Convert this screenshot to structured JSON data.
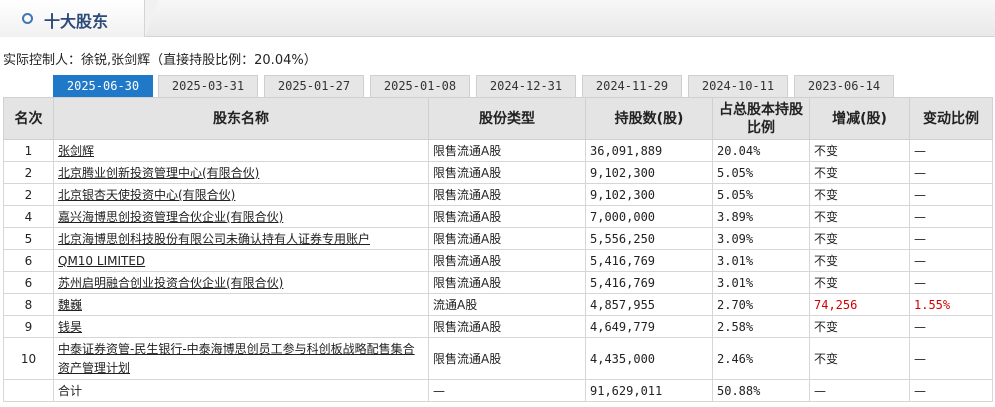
{
  "section": {
    "title": "十大股东"
  },
  "controller": {
    "label": "实际控制人：徐锐,张剑辉",
    "ratio_text": "（直接持股比例：20.04%）"
  },
  "date_tabs": [
    "2025-06-30",
    "2025-03-31",
    "2025-01-27",
    "2025-01-08",
    "2024-12-31",
    "2024-11-29",
    "2024-10-11",
    "2023-06-14"
  ],
  "active_tab": "2025-06-30",
  "table": {
    "headers": [
      "名次",
      "股东名称",
      "股份类型",
      "持股数(股)",
      "占总股本持股比例",
      "增减(股)",
      "变动比例"
    ],
    "rows": [
      {
        "rank": "1",
        "name": "张剑辉",
        "type": "限售流通A股",
        "shares": "36,091,889",
        "ratio": "20.04%",
        "change": "不变",
        "change_ratio": "—"
      },
      {
        "rank": "2",
        "name": "北京腾业创新投资管理中心(有限合伙)",
        "type": "限售流通A股",
        "shares": "9,102,300",
        "ratio": "5.05%",
        "change": "不变",
        "change_ratio": "—"
      },
      {
        "rank": "2",
        "name": "北京银杏天使投资中心(有限合伙)",
        "type": "限售流通A股",
        "shares": "9,102,300",
        "ratio": "5.05%",
        "change": "不变",
        "change_ratio": "—"
      },
      {
        "rank": "4",
        "name": "嘉兴海博思创投资管理合伙企业(有限合伙)",
        "type": "限售流通A股",
        "shares": "7,000,000",
        "ratio": "3.89%",
        "change": "不变",
        "change_ratio": "—"
      },
      {
        "rank": "5",
        "name": "北京海博思创科技股份有限公司未确认持有人证券专用账户",
        "type": "限售流通A股",
        "shares": "5,556,250",
        "ratio": "3.09%",
        "change": "不变",
        "change_ratio": "—"
      },
      {
        "rank": "6",
        "name": "QM10 LIMITED",
        "type": "限售流通A股",
        "shares": "5,416,769",
        "ratio": "3.01%",
        "change": "不变",
        "change_ratio": "—"
      },
      {
        "rank": "6",
        "name": "苏州启明融合创业投资合伙企业(有限合伙)",
        "type": "限售流通A股",
        "shares": "5,416,769",
        "ratio": "3.01%",
        "change": "不变",
        "change_ratio": "—"
      },
      {
        "rank": "8",
        "name": "魏巍",
        "type": "流通A股",
        "shares": "4,857,955",
        "ratio": "2.70%",
        "change": "74,256",
        "change_ratio": "1.55%",
        "changed": true
      },
      {
        "rank": "9",
        "name": "钱昊",
        "type": "限售流通A股",
        "shares": "4,649,779",
        "ratio": "2.58%",
        "change": "不变",
        "change_ratio": "—"
      },
      {
        "rank": "10",
        "name": "中泰证券资管-民生银行-中泰海博思创员工参与科创板战略配售集合资产管理计划",
        "type": "限售流通A股",
        "shares": "4,435,000",
        "ratio": "2.46%",
        "change": "不变",
        "change_ratio": "—",
        "tall": true
      }
    ],
    "total": {
      "label": "合计",
      "type": "—",
      "shares": "91,629,011",
      "ratio": "50.88%",
      "change": "—",
      "change_ratio": "—"
    }
  },
  "colors": {
    "active_tab": "#1f78c8",
    "increase": "#d40000",
    "title": "#2c4a7a"
  }
}
